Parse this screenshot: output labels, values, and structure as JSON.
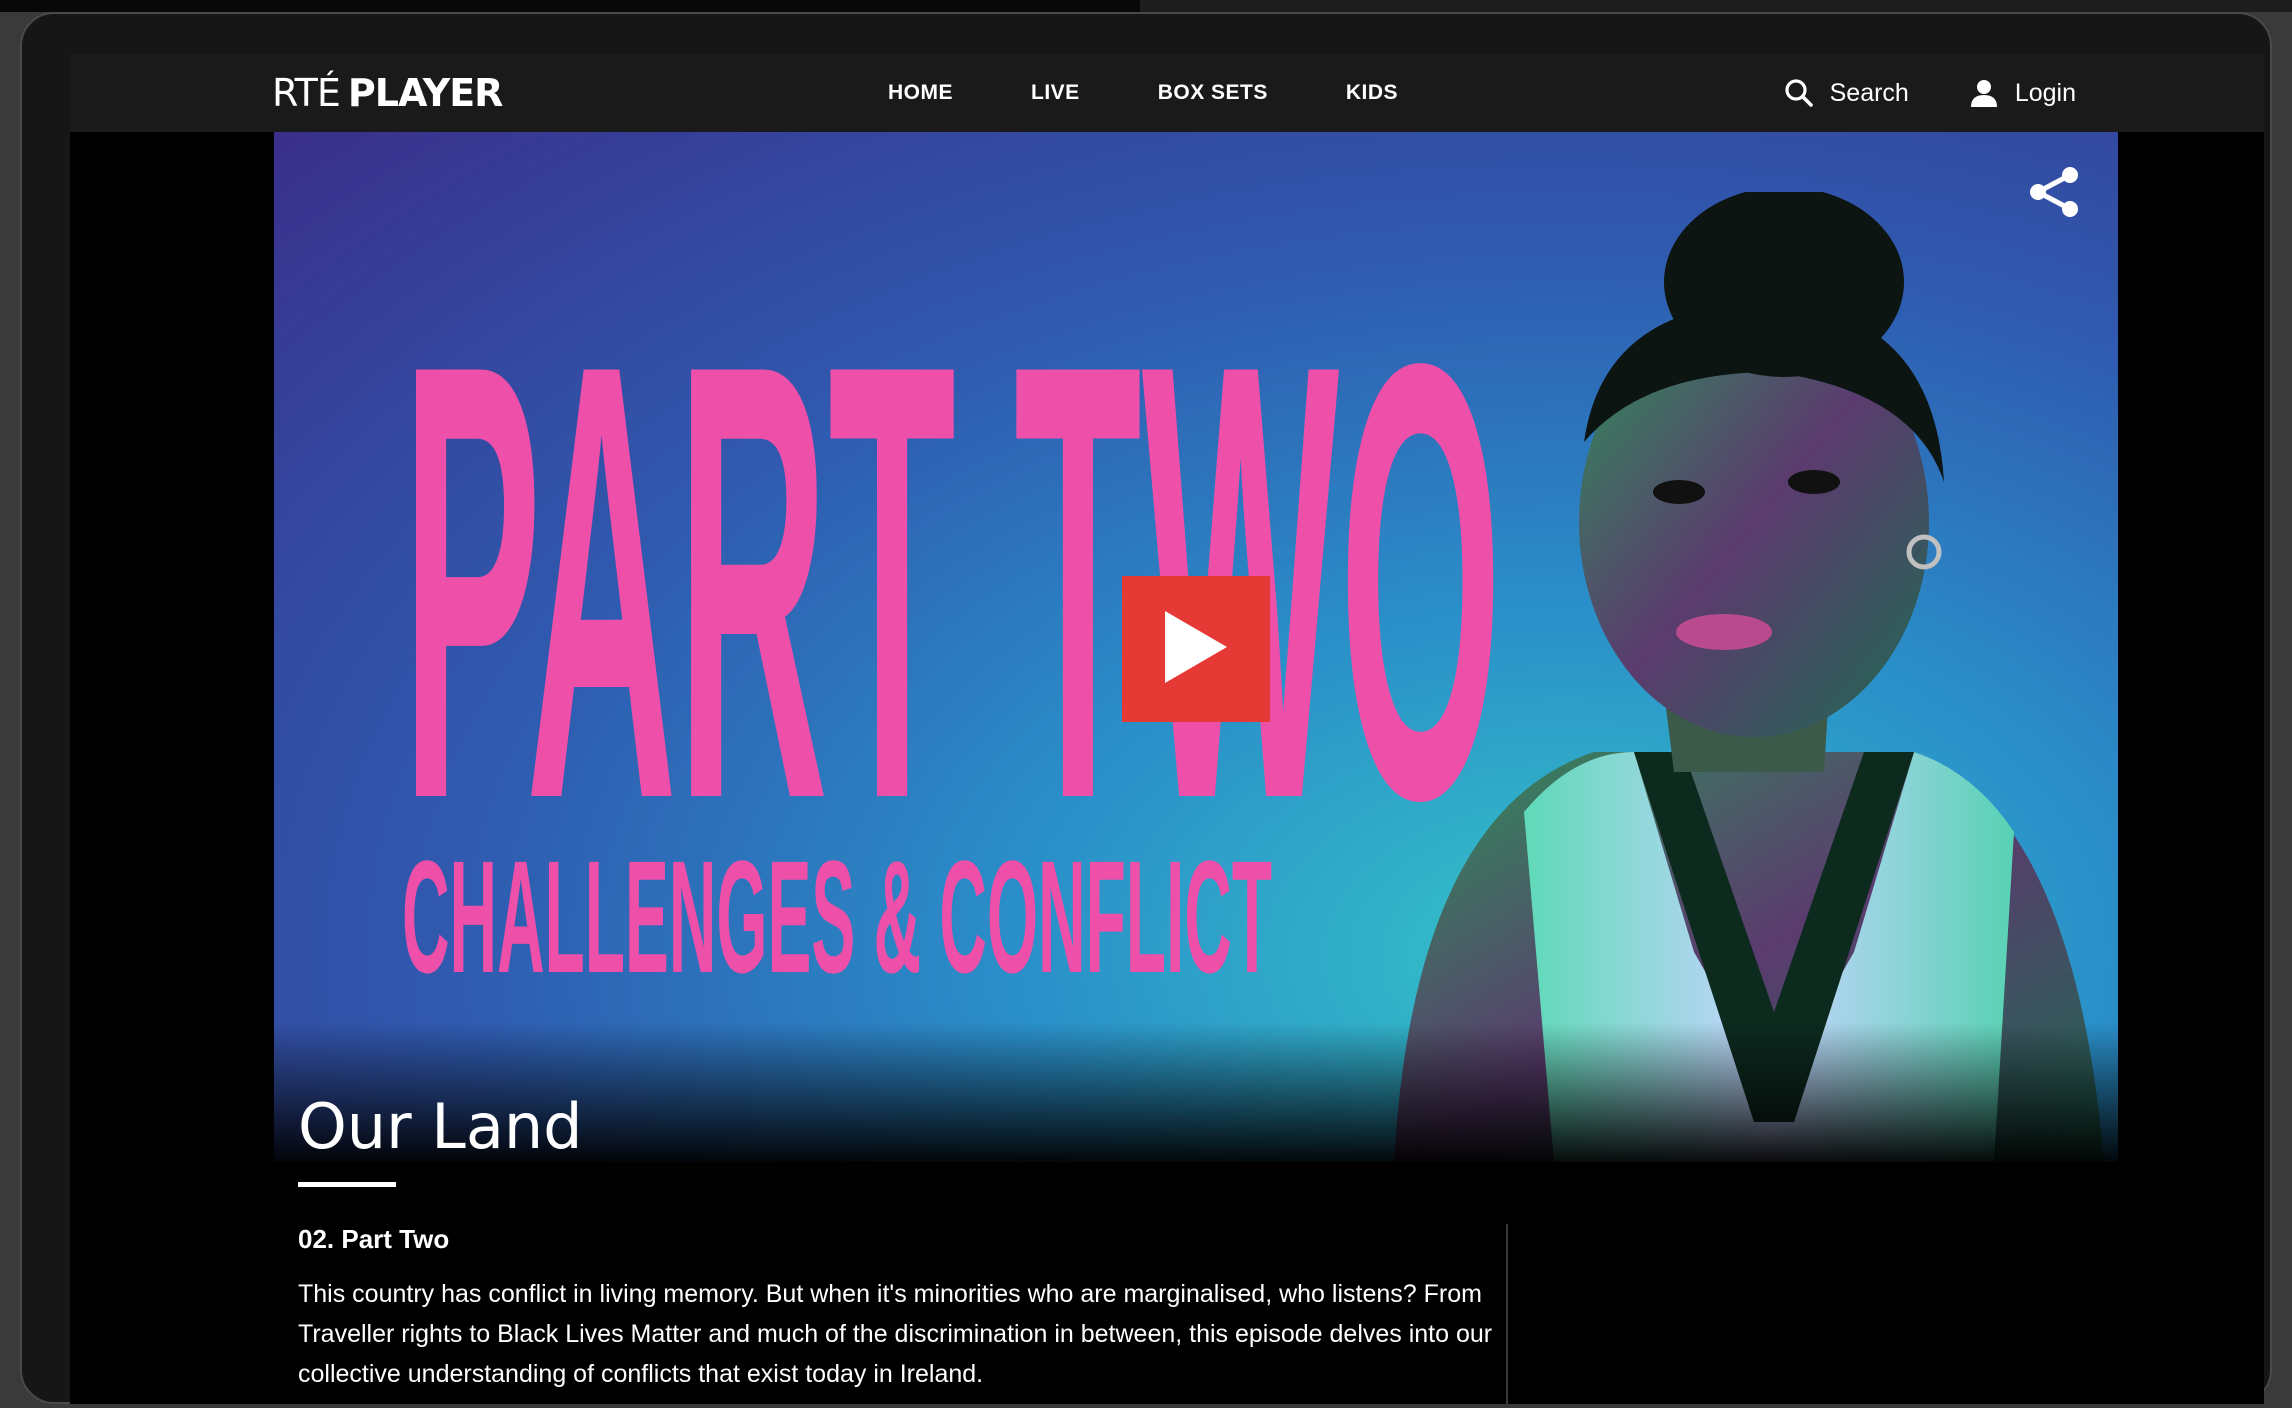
{
  "brand": {
    "rte": "RTÉ",
    "player": "PLAYER"
  },
  "nav": {
    "links": [
      "HOME",
      "LIVE",
      "BOX SETS",
      "KIDS"
    ],
    "search_label": "Search",
    "login_label": "Login"
  },
  "hero": {
    "artwork_headline": "PART TWO",
    "artwork_subheadline": "CHALLENGES & CONFLICT",
    "play_icon": "play-icon",
    "share_icon": "share-icon"
  },
  "show": {
    "title": "Our Land",
    "episode_title": "02. Part Two",
    "description": "This country has conflict in living memory. But when it's minorities who are marginalised, who listens? From Traveller rights to Black Lives Matter and much of the discrimination in between, this episode delves into our collective understanding of conflicts that exist today in Ireland."
  },
  "colors": {
    "accent": "#e53935",
    "artwork_pink": "#ee4fa9",
    "nav_bg": "#1a1a1a"
  }
}
